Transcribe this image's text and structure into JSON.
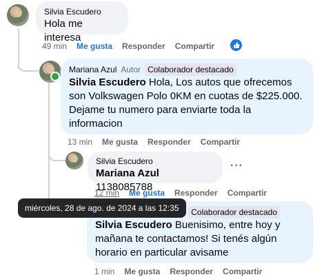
{
  "comments": [
    {
      "author": "Silvia Escudero",
      "text": "Hola me interesa",
      "time": "49 min",
      "like": "Me gusta",
      "reply": "Responder",
      "share": "Compartir"
    },
    {
      "author": "Mariana Azul",
      "author_badge": "Autor",
      "collab_badge": "Colaborador destacado",
      "mention": "Silvia Escudero",
      "text": " Hola, Los autos que ofrecemos son Volkswagen Polo 0KM en cuotas de $225.000. Dejame tu numero para enviarte toda la informacion",
      "time": "13 min",
      "like": "Me gusta",
      "reply": "Responder",
      "share": "Compartir"
    },
    {
      "author": "Silvia Escudero",
      "mention": "Mariana Azul",
      "text": " 1138085788",
      "time": "12 min",
      "like": "Me gusta",
      "reply": "Responder",
      "share": "Compartir"
    },
    {
      "collab_badge": "Colaborador destacado",
      "mention": "Silvia Escudero",
      "text": " Buenisimo, entre hoy y mañana te contactamos! Si tenés algún horario en particular avisame",
      "time": "1 min",
      "like": "Me gusta",
      "reply": "Responder",
      "share": "Compartir"
    }
  ],
  "tooltip": "miércoles, 28 de ago. de 2024 a las 12:35",
  "more_menu": "···",
  "colors": {
    "accent": "#1b74e4",
    "bubble_grey": "#f0f2f5",
    "bubble_blue": "#e7f3ff",
    "online": "#31a24c"
  }
}
